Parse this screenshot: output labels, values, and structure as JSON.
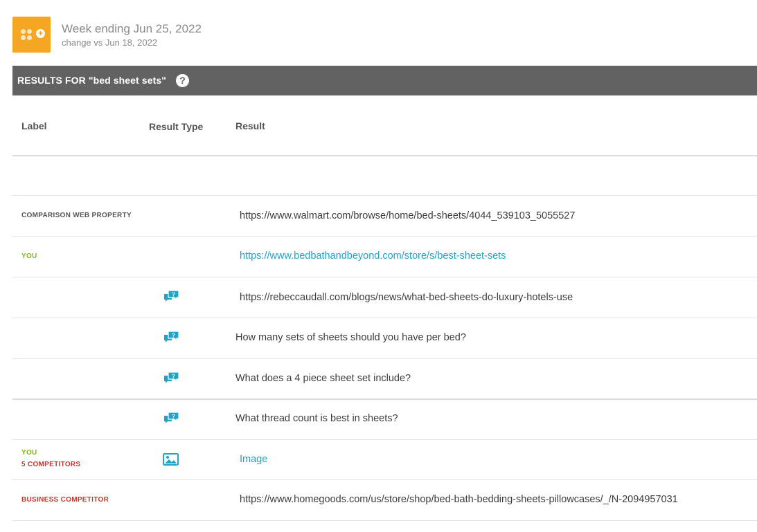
{
  "header": {
    "week_title": "Week ending Jun 25, 2022",
    "change_text": "change vs Jun 18, 2022"
  },
  "results_bar": {
    "title": "RESULTS FOR \"bed sheet sets\"",
    "help_symbol": "?"
  },
  "table": {
    "columns": [
      "Label",
      "Result Type",
      "Result"
    ],
    "rows": [
      {
        "labels": [
          {
            "text": "COMPARISON WEB PROPERTY",
            "color": "#555555"
          }
        ],
        "icon": "",
        "result": "https://www.walmart.com/browse/home/bed-sheets/4044_539103_5055527",
        "is_link": false
      },
      {
        "labels": [
          {
            "text": "YOU",
            "color": "#7cb518"
          }
        ],
        "icon": "",
        "result": "https://www.bedbathandbeyond.com/store/s/best-sheet-sets",
        "is_link": true
      },
      {
        "labels": [],
        "icon": "question-bubble-icon",
        "result": "https://rebeccaudall.com/blogs/news/what-bed-sheets-do-luxury-hotels-use",
        "is_link": false
      },
      {
        "labels": [],
        "icon": "question-bubble-icon",
        "result": "How many sets of sheets should you have per bed?",
        "is_link": false
      },
      {
        "labels": [],
        "icon": "question-bubble-icon",
        "result": "What does a 4 piece sheet set include?",
        "is_link": false
      },
      {
        "labels": [],
        "icon": "question-bubble-icon",
        "result": "What thread count is best in sheets?",
        "is_link": false
      },
      {
        "labels": [
          {
            "text": "YOU",
            "color": "#7cb518"
          },
          {
            "text": "5 COMPETITORS",
            "color": "#c0392b"
          }
        ],
        "icon": "image-icon",
        "result": "Image",
        "is_link": true
      },
      {
        "labels": [
          {
            "text": "BUSINESS COMPETITOR",
            "color": "#c0392b"
          }
        ],
        "icon": "",
        "result": "https://www.homegoods.com/us/store/shop/bed-bath-bedding-sheets-pillowcases/_/N-2094957031",
        "is_link": false
      }
    ]
  },
  "colors": {
    "brand_orange": "#f5a623",
    "bar_grey": "#626262",
    "link_blue": "#21a3c7",
    "label_green": "#7cb518",
    "label_red": "#c0392b"
  }
}
